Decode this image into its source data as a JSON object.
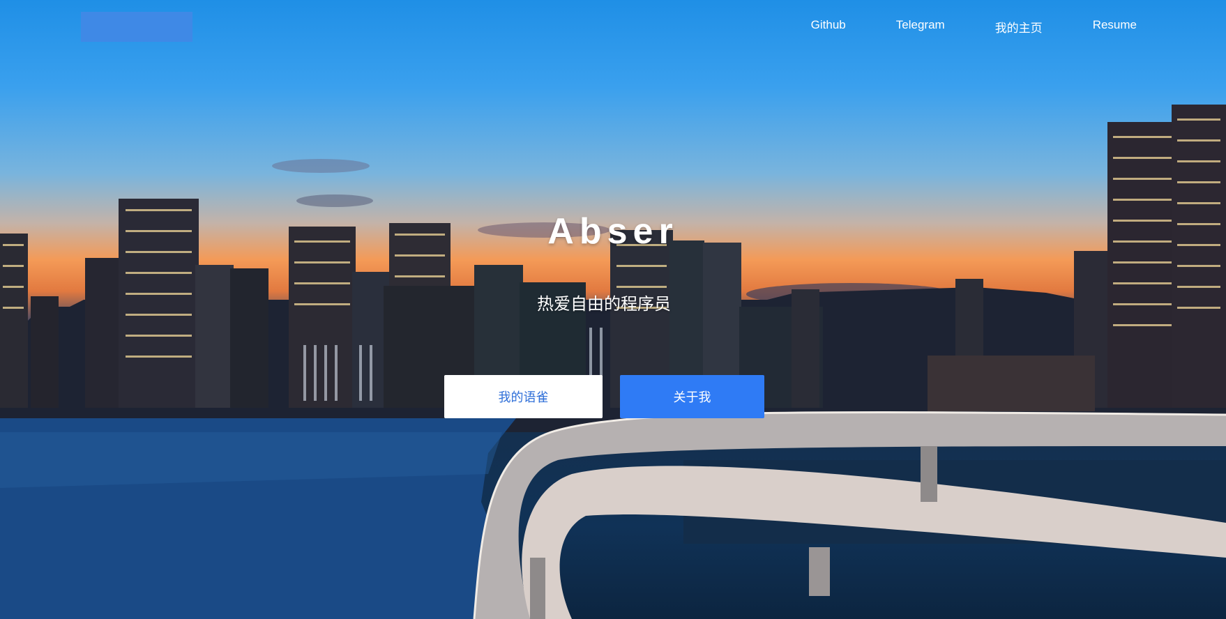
{
  "header": {
    "nav": [
      {
        "label": "Github"
      },
      {
        "label": "Telegram"
      },
      {
        "label": "我的主页"
      },
      {
        "label": "Resume"
      }
    ]
  },
  "hero": {
    "title": "Abser",
    "subtitle": "热爱自由的程序员",
    "primary_button": "我的语雀",
    "secondary_button": "关于我"
  },
  "colors": {
    "logo": "#3f89e6",
    "accent": "#2f7bf5",
    "button_text": "#2f6fd8"
  }
}
